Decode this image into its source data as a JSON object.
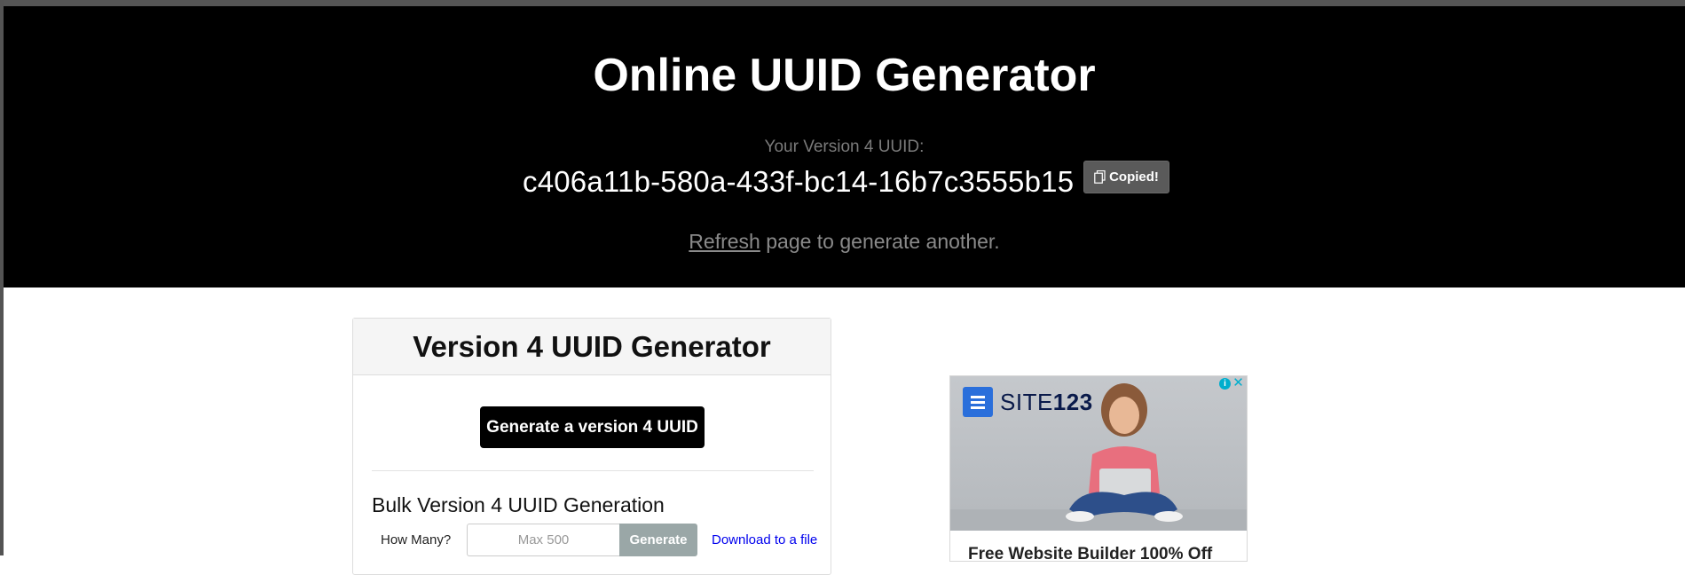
{
  "hero": {
    "title": "Online UUID Generator",
    "uuid_label": "Your Version 4 UUID:",
    "uuid_value": "c406a11b-580a-433f-bc14-16b7c3555b15",
    "copy_button_label": "Copied!",
    "refresh_link": "Refresh",
    "refresh_suffix": " page to generate another."
  },
  "card": {
    "title": "Version 4 UUID Generator",
    "generate_button": "Generate a version 4 UUID",
    "bulk_title": "Bulk Version 4 UUID Generation",
    "how_many_label": "How Many?",
    "count_placeholder": "Max 500",
    "bulk_generate_button": "Generate",
    "download_link": "Download to a file"
  },
  "ad": {
    "logo_text_a": "SITE",
    "logo_text_b": "123",
    "info_icon": "i",
    "close_icon": "✕",
    "headline": "Free Website Builder 100% Off"
  },
  "colors": {
    "hero_bg": "#000000",
    "copy_button_bg": "#5a5a5a",
    "bulk_generate_bg": "#9aa7a7",
    "link": "#0000ee",
    "ad_accent": "#00aecd"
  }
}
